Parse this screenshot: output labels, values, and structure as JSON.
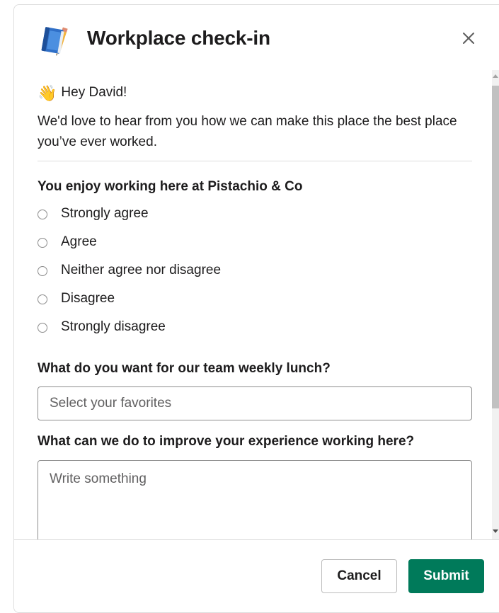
{
  "modal": {
    "title": "Workplace check-in",
    "app_icon": "notebook-icon",
    "close_icon": "close-icon"
  },
  "greeting": {
    "emoji": "👋",
    "text": "Hey David!"
  },
  "intro": "We'd love to hear from you how we can make this place the best place you’ve ever worked.",
  "question1": {
    "label": "You enjoy working here at Pistachio & Co",
    "options": [
      "Strongly agree",
      "Agree",
      "Neither agree nor disagree",
      "Disagree",
      "Strongly disagree"
    ]
  },
  "question2": {
    "label": "What do you want for our team weekly lunch?",
    "placeholder": "Select your favorites"
  },
  "question3": {
    "label": "What can we do to improve your experience working here?",
    "placeholder": "Write something"
  },
  "footer": {
    "cancel_label": "Cancel",
    "submit_label": "Submit"
  },
  "colors": {
    "primary": "#007a5a",
    "text": "#1d1c1d",
    "placeholder": "#616061",
    "border": "#dddddd"
  }
}
